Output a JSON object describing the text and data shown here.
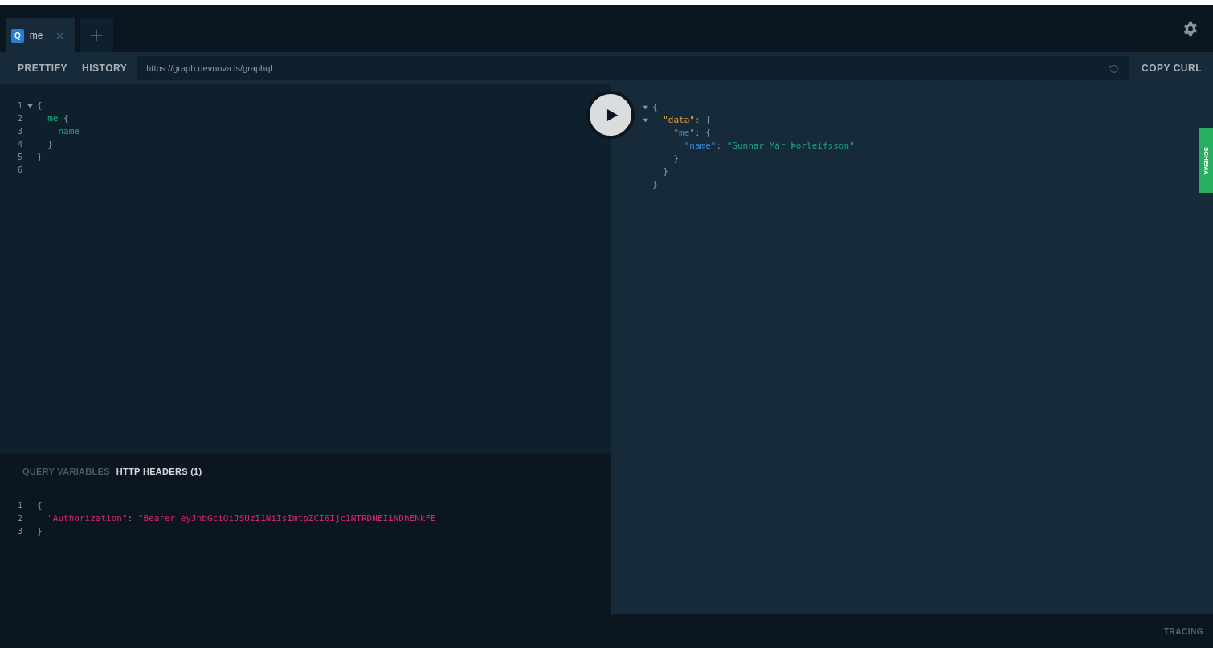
{
  "tabs": [
    {
      "badge": "Q",
      "label": "me",
      "selected": true
    }
  ],
  "toolbar": {
    "buttons": [
      "PRETTIFY",
      "HISTORY"
    ],
    "endpoint": "https://graph.devnova.is/graphql",
    "copy_button": "COPY CURL"
  },
  "query_editor": {
    "lines": [
      {
        "number": "1",
        "fold": true,
        "tokens": [
          {
            "kind": "punct",
            "text": "{"
          }
        ]
      },
      {
        "number": "2",
        "fold": false,
        "tokens": [
          {
            "kind": "field",
            "text": "  me"
          },
          {
            "kind": "punct",
            "text": " {"
          }
        ]
      },
      {
        "number": "3",
        "fold": false,
        "tokens": [
          {
            "kind": "field",
            "text": "    name"
          }
        ]
      },
      {
        "number": "4",
        "fold": false,
        "tokens": [
          {
            "kind": "punct",
            "text": "  }"
          }
        ]
      },
      {
        "number": "5",
        "fold": false,
        "tokens": [
          {
            "kind": "punct",
            "text": "}"
          }
        ]
      },
      {
        "number": "6",
        "fold": false
      }
    ]
  },
  "variables": {
    "tabs": [
      {
        "label": "QUERY VARIABLES",
        "selected": false
      },
      {
        "label": "HTTP HEADERS (1)",
        "selected": true
      }
    ],
    "lines": [
      {
        "number": "1",
        "tokens": [
          {
            "kind": "punct",
            "text": "{"
          }
        ]
      },
      {
        "number": "2",
        "tokens": [
          {
            "kind": "key",
            "text": "  \"Authorization\""
          },
          {
            "kind": "punct",
            "text": ": "
          },
          {
            "kind": "key",
            "text": "\"Bearer eyJhbGciOiJSUzI1NiIsImtpZCI6Ijc1NTRDNEI1NDhENkFE"
          }
        ]
      },
      {
        "number": "3",
        "tokens": [
          {
            "kind": "punct",
            "text": "}"
          }
        ]
      }
    ]
  },
  "result": {
    "lines": [
      {
        "fold": true,
        "tokens": [
          {
            "kind": "punct",
            "text": "{"
          }
        ]
      },
      {
        "fold": true,
        "tokens": [
          {
            "kind": "prop",
            "text": "  \"data\""
          },
          {
            "kind": "punct",
            "text": ": {"
          }
        ]
      },
      {
        "fold": false,
        "tokens": [
          {
            "kind": "attr",
            "text": "    \"me\""
          },
          {
            "kind": "punct",
            "text": ": {"
          }
        ]
      },
      {
        "fold": false,
        "tokens": [
          {
            "kind": "attr",
            "text": "      \"name\""
          },
          {
            "kind": "punct",
            "text": ": "
          },
          {
            "kind": "string",
            "text": "\"Gunnar Már Þorleifsson\""
          }
        ]
      },
      {
        "fold": false,
        "tokens": [
          {
            "kind": "punct",
            "text": "    }"
          }
        ]
      },
      {
        "fold": false,
        "tokens": [
          {
            "kind": "punct",
            "text": "  }"
          }
        ]
      },
      {
        "fold": false,
        "tokens": [
          {
            "kind": "punct",
            "text": "}"
          }
        ]
      }
    ]
  },
  "schema_tab": "SCHEMA",
  "footer": {
    "tracing": "TRACING"
  }
}
